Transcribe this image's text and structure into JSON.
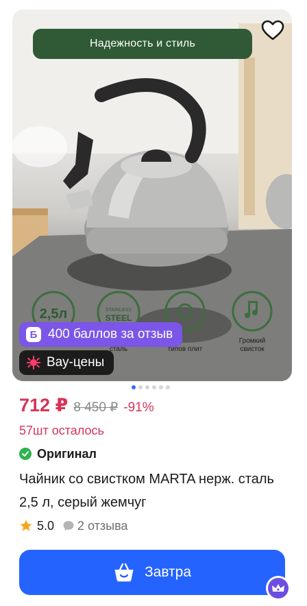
{
  "product": {
    "banner_text": "Надежность и стиль",
    "badges": {
      "points_icon": "Б",
      "points_text": "400 баллов за отзыв",
      "wow_text": "Вау-цены"
    },
    "image_dots": {
      "total": 6,
      "active_index": 0
    },
    "price": "712 ₽",
    "old_price": "8 450 ₽",
    "discount": "-91%",
    "stock": "57шт осталось",
    "original_label": "Оригинал",
    "title": "Чайник со свистком MARTA нерж. сталь 2,5 л, серый жемчуг",
    "rating": "5.0",
    "reviews": "2 отзыва",
    "buy_button_label": "Завтра"
  },
  "photo_labels": {
    "volume": "2,5л",
    "steel_top": "STAINLESS",
    "steel_bottom": "STEEL",
    "steel_caption": "сталь",
    "stoves_caption": "типов плит",
    "whistle_caption_1": "Громкий",
    "whistle_caption_2": "свисток"
  },
  "colors": {
    "price": "#d6345a",
    "accent_blue": "#2563ff",
    "points_purple": "#7b56e8",
    "banner_green": "#2f5a35",
    "original_green": "#2eb34f"
  },
  "icons": [
    "heart-icon",
    "points-b-icon",
    "wow-sparkle-icon",
    "check-icon",
    "star-icon",
    "comment-icon",
    "basket-icon",
    "crown-icon"
  ]
}
